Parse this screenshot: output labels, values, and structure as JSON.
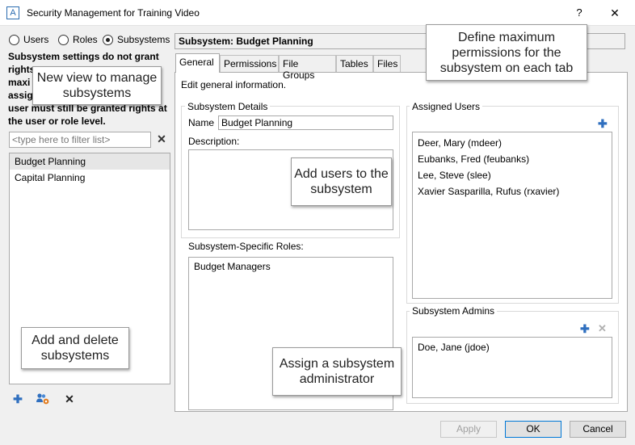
{
  "window": {
    "title": "Security Management for Training Video",
    "icon_letter": "A",
    "help": "?",
    "close": "✕"
  },
  "view_modes": {
    "users": "Users",
    "roles": "Roles",
    "subsystems": "Subsystems",
    "selected": "subsystems"
  },
  "left": {
    "note_lines": [
      "Subsystem settings do not grant",
      "rights",
      "maxi",
      "assig",
      "user must still be granted rights at",
      "the user or role level."
    ],
    "filter_placeholder": "<type here to filter list>",
    "filter_clear": "✕",
    "subsystems": [
      {
        "label": "Budget Planning",
        "selected": true
      },
      {
        "label": "Capital Planning",
        "selected": false
      }
    ],
    "tools": {
      "add": "✚",
      "delete": "✕"
    }
  },
  "right": {
    "header": "Subsystem: Budget Planning",
    "tabs": [
      "General",
      "Permissions",
      "File Groups",
      "Tables",
      "Files"
    ],
    "active_tab": "General",
    "tab_description": "Edit general information.",
    "details": {
      "title": "Subsystem Details",
      "name_label": "Name",
      "name_value": "Budget Planning",
      "description_label": "Description:",
      "description_value": ""
    },
    "roles": {
      "label": "Subsystem-Specific Roles:",
      "items": [
        "Budget Managers"
      ]
    },
    "assigned_users": {
      "title": "Assigned Users",
      "add": "✚",
      "items": [
        "Deer, Mary (mdeer)",
        "Eubanks, Fred (feubanks)",
        "Lee, Steve (slee)",
        "Xavier Sasparilla, Rufus (rxavier)"
      ]
    },
    "admins": {
      "title": "Subsystem Admins",
      "add": "✚",
      "remove": "✕",
      "items": [
        "Doe, Jane (jdoe)"
      ]
    }
  },
  "buttons": {
    "apply": "Apply",
    "ok": "OK",
    "cancel": "Cancel"
  },
  "callouts": {
    "new_view": "New view to manage subsystems",
    "define_max": "Define maximum permissions for the subsystem on each tab",
    "add_users": "Add users to the subsystem",
    "add_delete": "Add and delete subsystems",
    "assign_admin": "Assign a subsystem administrator"
  },
  "colors": {
    "accent_blue": "#2f6fbf",
    "ok_border": "#0078d7",
    "disabled_text": "#a0a0a0"
  }
}
